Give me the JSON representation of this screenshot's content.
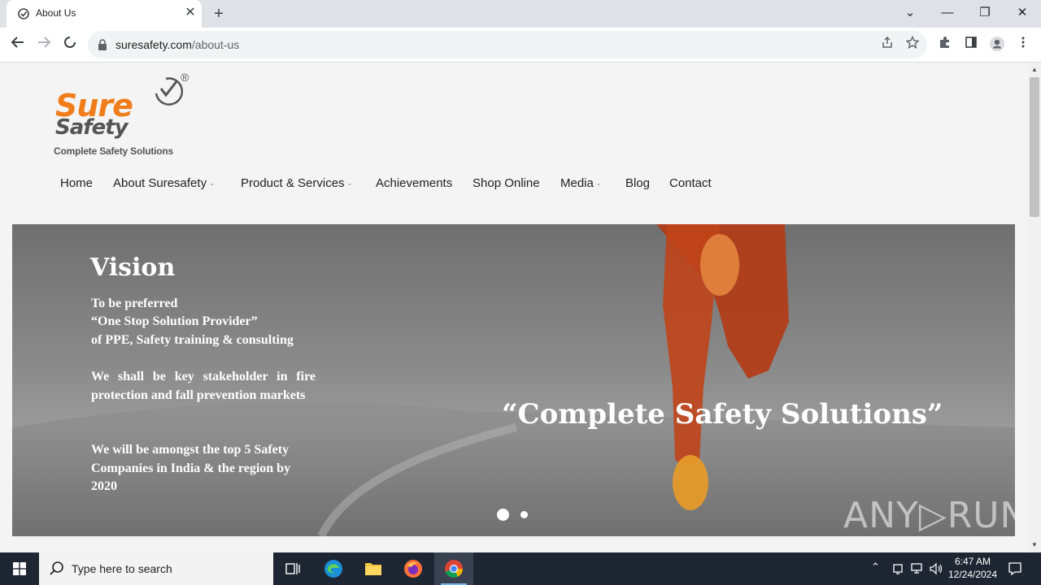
{
  "browser": {
    "tab_title": "About Us",
    "tab_close": "✕",
    "new_tab": "+",
    "url_domain": "suresafety.com",
    "url_path": "/about-us",
    "window_controls": {
      "dropdown": "⌄",
      "minimize": "—",
      "restore": "❐",
      "close": "✕"
    }
  },
  "site": {
    "logo": {
      "word1": "Sure",
      "word2": "Safety",
      "tagline": "Complete Safety Solutions",
      "registered": "®"
    },
    "nav": [
      {
        "label": "Home",
        "dropdown": false
      },
      {
        "label": "About Suresafety",
        "dropdown": true
      },
      {
        "label": "Product & Services",
        "dropdown": true
      },
      {
        "label": "Achievements",
        "dropdown": false
      },
      {
        "label": "Shop Online",
        "dropdown": false
      },
      {
        "label": "Media",
        "dropdown": true
      },
      {
        "label": "Blog",
        "dropdown": false
      },
      {
        "label": "Contact",
        "dropdown": false
      }
    ],
    "caret": "⌄",
    "hero": {
      "heading": "Vision",
      "para1_line1": "To be preferred",
      "para1_line2": "“One Stop Solution Provider”",
      "para1_line3": "of PPE, Safety training & consulting",
      "para2": "We shall be key stakeholder in fire protection and fall prevention markets",
      "para3": "We will be amongst the top 5 Safety Companies in India & the region by 2020",
      "slogan": "“Complete Safety Solutions”",
      "slides": 2,
      "active_slide": 1
    },
    "watermark": "ANY▷RUN"
  },
  "taskbar": {
    "search_placeholder": "Type here to search",
    "time": "6:47 AM",
    "date": "12/24/2024"
  },
  "colors": {
    "brand_orange": "#f07d1a",
    "brand_gray": "#555555",
    "taskbar": "#1f2633"
  }
}
